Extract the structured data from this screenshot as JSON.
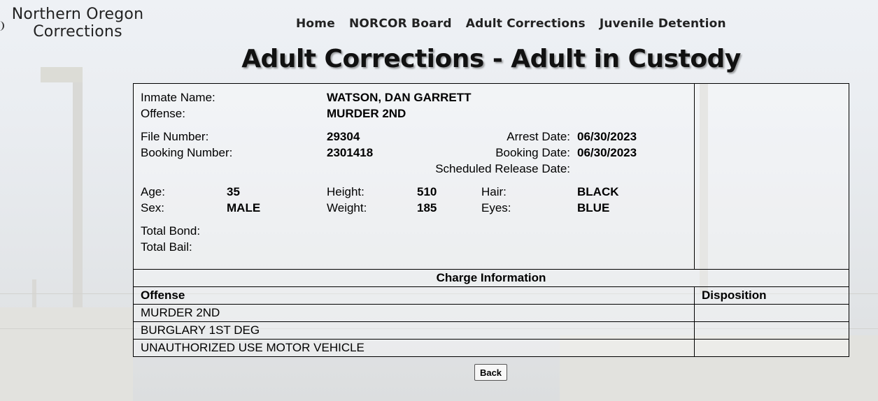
{
  "site": {
    "logo_line1": "Northern Oregon",
    "logo_line2": "Corrections"
  },
  "nav": {
    "items": [
      {
        "label": "Home"
      },
      {
        "label": "NORCOR Board"
      },
      {
        "label": "Adult Corrections"
      },
      {
        "label": "Juvenile Detention"
      }
    ]
  },
  "page": {
    "title": "Adult Corrections - Adult in Custody"
  },
  "inmate": {
    "name_label": "Inmate Name:",
    "name": "WATSON, DAN GARRETT",
    "offense_label": "Offense:",
    "offense": "MURDER 2ND",
    "file_number_label": "File Number:",
    "file_number": "29304",
    "booking_number_label": "Booking Number:",
    "booking_number": "2301418",
    "arrest_date_label": "Arrest Date:",
    "arrest_date": "06/30/2023",
    "booking_date_label": "Booking Date:",
    "booking_date": "06/30/2023",
    "release_date_label": "Scheduled Release Date:",
    "release_date": "",
    "age_label": "Age:",
    "age": "35",
    "sex_label": "Sex:",
    "sex": "MALE",
    "height_label": "Height:",
    "height": "510",
    "weight_label": "Weight:",
    "weight": "185",
    "hair_label": "Hair:",
    "hair": "BLACK",
    "eyes_label": "Eyes:",
    "eyes": "BLUE",
    "total_bond_label": "Total Bond:",
    "total_bond": "",
    "total_bail_label": "Total Bail:",
    "total_bail": ""
  },
  "charges": {
    "heading": "Charge Information",
    "columns": {
      "offense": "Offense",
      "disposition": "Disposition"
    },
    "rows": [
      {
        "offense": "MURDER 2ND",
        "disposition": ""
      },
      {
        "offense": "BURGLARY 1ST DEG",
        "disposition": ""
      },
      {
        "offense": "UNAUTHORIZED USE MOTOR VEHICLE",
        "disposition": ""
      }
    ]
  },
  "actions": {
    "back_label": "Back"
  }
}
